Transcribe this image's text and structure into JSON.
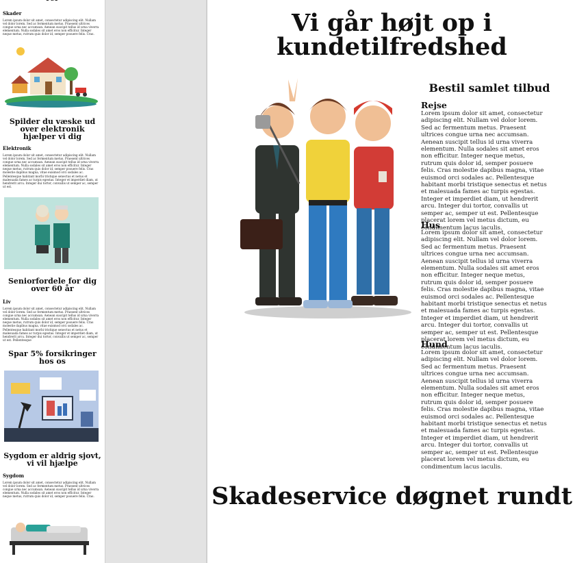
{
  "left": {
    "top_heading_fragment": "rer",
    "sections": [
      {
        "heading": "",
        "sub": "Skader",
        "body": "Lorem ipsum dolor sit amet, consectetur adipiscing elit. Nullam vel dolor lorem. Sed ac fermentum metus. Praesent ultrices congue urna nec accumsan. Aenean suscipit tellus id urna viverra elementum. Nulla sodales sit amet eros non efficitur. Integer neque metus, rutrum quis dolor id, semper posuere felis. Cras."
      },
      {
        "heading": "Spilder du væske ud over elektronik hjælper vi dig",
        "sub": "Elektronik",
        "body": "Lorem ipsum dolor sit amet, consectetur adipiscing elit. Nullam vel dolor lorem. Sed ac fermentum metus. Praesent ultrices congue urna nec accumsan. Aenean suscipit tellus id urna viverra elementum. Nulla sodales sit amet eros non efficitur. Integer neque metus, rutrum quis dolor id, semper posuere felis. Cras molestie dapibus magna, vitae euismod orci sodales ac. Pellentesque habitant morbi tristique senectus et netus et malesuada fames ac turpis egestas. Integer et imperdiet diam, ut hendrerit arcu. Integer dui tortor, convallis ut semper ac, semper ut est."
      },
      {
        "heading": "Seniorfordele for dig over 60 år",
        "sub": "Liv",
        "body": "Lorem ipsum dolor sit amet, consectetur adipiscing elit. Nullam vel dolor lorem. Sed ac fermentum metus. Praesent ultrices congue urna nec accumsan. Aenean suscipit tellus id urna viverra elementum. Nulla sodales sit amet eros non efficitur. Integer neque metus, rutrum quis dolor id, semper posuere felis. Cras molestie dapibus magna, vitae euismod orci sodales ac. Pellentesque habitant morbi tristique senectus et netus et malesuada fames ac turpis egestas. Integer et imperdiet diam, ut hendrerit arcu. Integer dui tortor, convallis ut semper ac, semper ut est. Pellentesque"
      },
      {
        "heading": "Spar 5% forsikringer hos os",
        "sub": "",
        "body": ""
      },
      {
        "heading": "Sygdom er aldrig sjovt, vi vil hjælpe",
        "sub": "Sygdom",
        "body": "Lorem ipsum dolor sit amet, consectetur adipiscing elit. Nullam vel dolor lorem. Sed ac fermentum metus. Praesent ultrices congue urna nec accumsan. Aenean suscipit tellus id urna viverra elementum. Nulla sodales sit amet eros non efficitur. Integer neque metus, rutrum quis dolor id, semper posuere felis. Cras."
      }
    ]
  },
  "main": {
    "title": "Vi går højt op i kundetilfredshed",
    "bottom_title": "Skadeservice døgnet rundt",
    "offer_heading": "Bestil samlet tilbud",
    "offers": [
      {
        "sub": "Rejse",
        "body": "Lorem ipsum dolor sit amet, consectetur adipiscing elit. Nullam vel dolor lorem. Sed ac fermentum metus. Praesent ultrices congue urna nec accumsan. Aenean suscipit tellus id urna viverra elementum. Nulla sodales sit amet eros non efficitur. Integer neque metus, rutrum quis dolor id, semper posuere felis. Cras molestie dapibus magna, vitae euismod orci sodales ac. Pellentesque habitant morbi tristique senectus et netus et malesuada fames ac turpis egestas. Integer et imperdiet diam, ut hendrerit arcu. Integer dui tortor, convallis ut semper ac, semper ut est. Pellentesque placerat lorem vel metus dictum, eu condimentum lacus iaculis."
      },
      {
        "sub": "Hus",
        "body": "Lorem ipsum dolor sit amet, consectetur adipiscing elit. Nullam vel dolor lorem. Sed ac fermentum metus. Praesent ultrices congue urna nec accumsan. Aenean suscipit tellus id urna viverra elementum. Nulla sodales sit amet eros non efficitur. Integer neque metus, rutrum quis dolor id, semper posuere felis. Cras molestie dapibus magna, vitae euismod orci sodales ac. Pellentesque habitant morbi tristique senectus et netus et malesuada fames ac turpis egestas. Integer et imperdiet diam, ut hendrerit arcu. Integer dui tortor, convallis ut semper ac, semper ut est. Pellentesque placerat lorem vel metus dictum, eu condimentum lacus iaculis."
      },
      {
        "sub": "Hund",
        "body": "Lorem ipsum dolor sit amet, consectetur adipiscing elit. Nullam vel dolor lorem. Sed ac fermentum metus. Praesent ultrices congue urna nec accumsan. Aenean suscipit tellus id urna viverra elementum. Nulla sodales sit amet eros non efficitur. Integer neque metus, rutrum quis dolor id, semper posuere felis. Cras molestie dapibus magna, vitae euismod orci sodales ac. Pellentesque habitant morbi tristique senectus et netus et malesuada fames ac turpis egestas. Integer et imperdiet diam, ut hendrerit arcu. Integer dui tortor, convallis ut semper ac, semper ut est. Pellentesque placerat lorem vel metus dictum, eu condimentum lacus iaculis."
      }
    ]
  },
  "colors": {
    "gutter": "#e3e3e3",
    "text": "#111111"
  }
}
